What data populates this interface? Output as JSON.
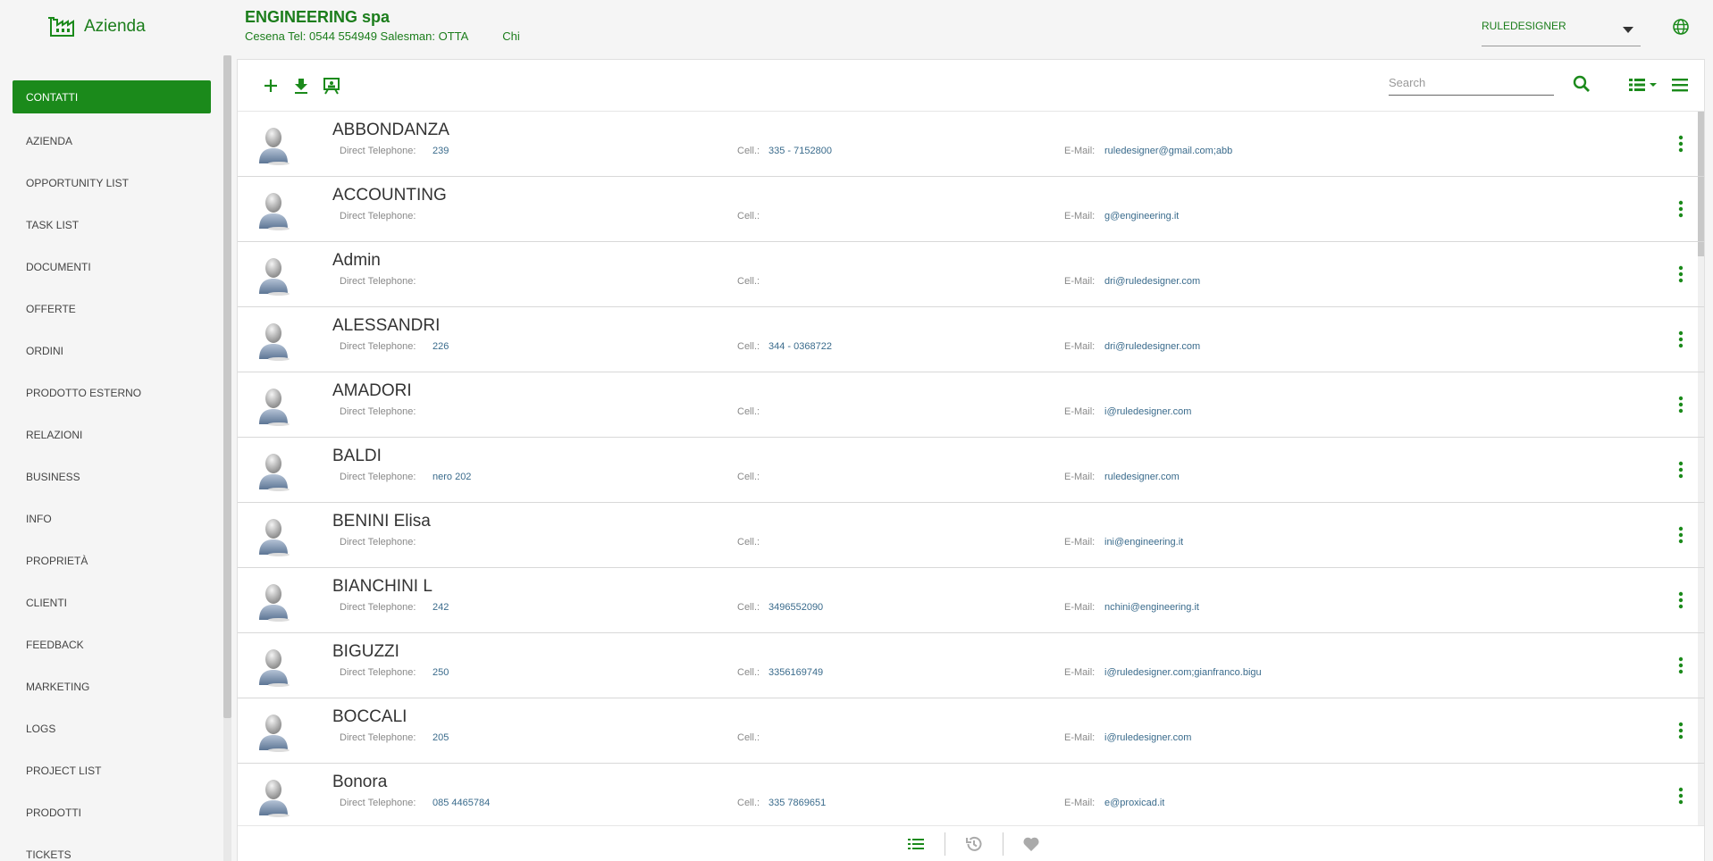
{
  "header": {
    "brand_title": "Azienda",
    "company_name": "ENGINEERING spa",
    "company_details": "Cesena Tel: 0544 554949 Salesman: OTTA",
    "company_extra": "Chi",
    "user": "RULEDESIGNER"
  },
  "sidebar": {
    "items": [
      {
        "label": "CONTATTI",
        "active": true
      },
      {
        "label": "AZIENDA"
      },
      {
        "label": "OPPORTUNITY LIST"
      },
      {
        "label": "TASK LIST"
      },
      {
        "label": "DOCUMENTI"
      },
      {
        "label": "OFFERTE"
      },
      {
        "label": "ORDINI"
      },
      {
        "label": "PRODOTTO ESTERNO"
      },
      {
        "label": "RELAZIONI"
      },
      {
        "label": "BUSINESS"
      },
      {
        "label": "INFO"
      },
      {
        "label": "PROPRIETÀ"
      },
      {
        "label": "CLIENTI"
      },
      {
        "label": "FEEDBACK"
      },
      {
        "label": "MARKETING"
      },
      {
        "label": "LOGS"
      },
      {
        "label": "PROJECT LIST"
      },
      {
        "label": "PRODOTTI"
      },
      {
        "label": "TICKETS"
      }
    ]
  },
  "toolbar": {
    "search_placeholder": "Search",
    "icons": [
      "plus-icon",
      "download-icon",
      "presentation-icon",
      "search-icon",
      "list-view-icon",
      "menu-icon"
    ]
  },
  "labels": {
    "phone": "Direct Telephone:",
    "cell": "Cell.:",
    "email": "E-Mail:"
  },
  "contacts": [
    {
      "name": "ABBONDANZA",
      "phone": "239",
      "cell": "335 - 7152800",
      "email": "ruledesigner@gmail.com;abb"
    },
    {
      "name": "ACCOUNTING",
      "phone": "",
      "cell": "",
      "email": "g@engineering.it"
    },
    {
      "name": "Admin",
      "phone": "",
      "cell": "",
      "email": "dri@ruledesigner.com"
    },
    {
      "name": "ALESSANDRI",
      "phone": "226",
      "cell": "344 - 0368722",
      "email": "dri@ruledesigner.com"
    },
    {
      "name": "AMADORI",
      "phone": "",
      "cell": "",
      "email": "i@ruledesigner.com"
    },
    {
      "name": "BALDI",
      "phone": "nero 202",
      "cell": "",
      "email": "ruledesigner.com"
    },
    {
      "name": "BENINI Elisa",
      "phone": "",
      "cell": "",
      "email": "ini@engineering.it"
    },
    {
      "name": "BIANCHINI L",
      "phone": "242",
      "cell": "3496552090",
      "email": "nchini@engineering.it"
    },
    {
      "name": "BIGUZZI",
      "phone": "250",
      "cell": "3356169749",
      "email": "i@ruledesigner.com;gianfranco.bigu"
    },
    {
      "name": "BOCCALI",
      "phone": "205",
      "cell": "",
      "email": "i@ruledesigner.com"
    },
    {
      "name": "Bonora",
      "phone": "085 4465784",
      "cell": "335 7869651",
      "email": "e@proxicad.it"
    }
  ],
  "bottom_icons": [
    "list-icon",
    "history-icon",
    "heart-icon"
  ],
  "colors": {
    "accent": "#1b8a1b",
    "brand_text": "#1b7d1b",
    "value_text": "#3a6b8c"
  }
}
